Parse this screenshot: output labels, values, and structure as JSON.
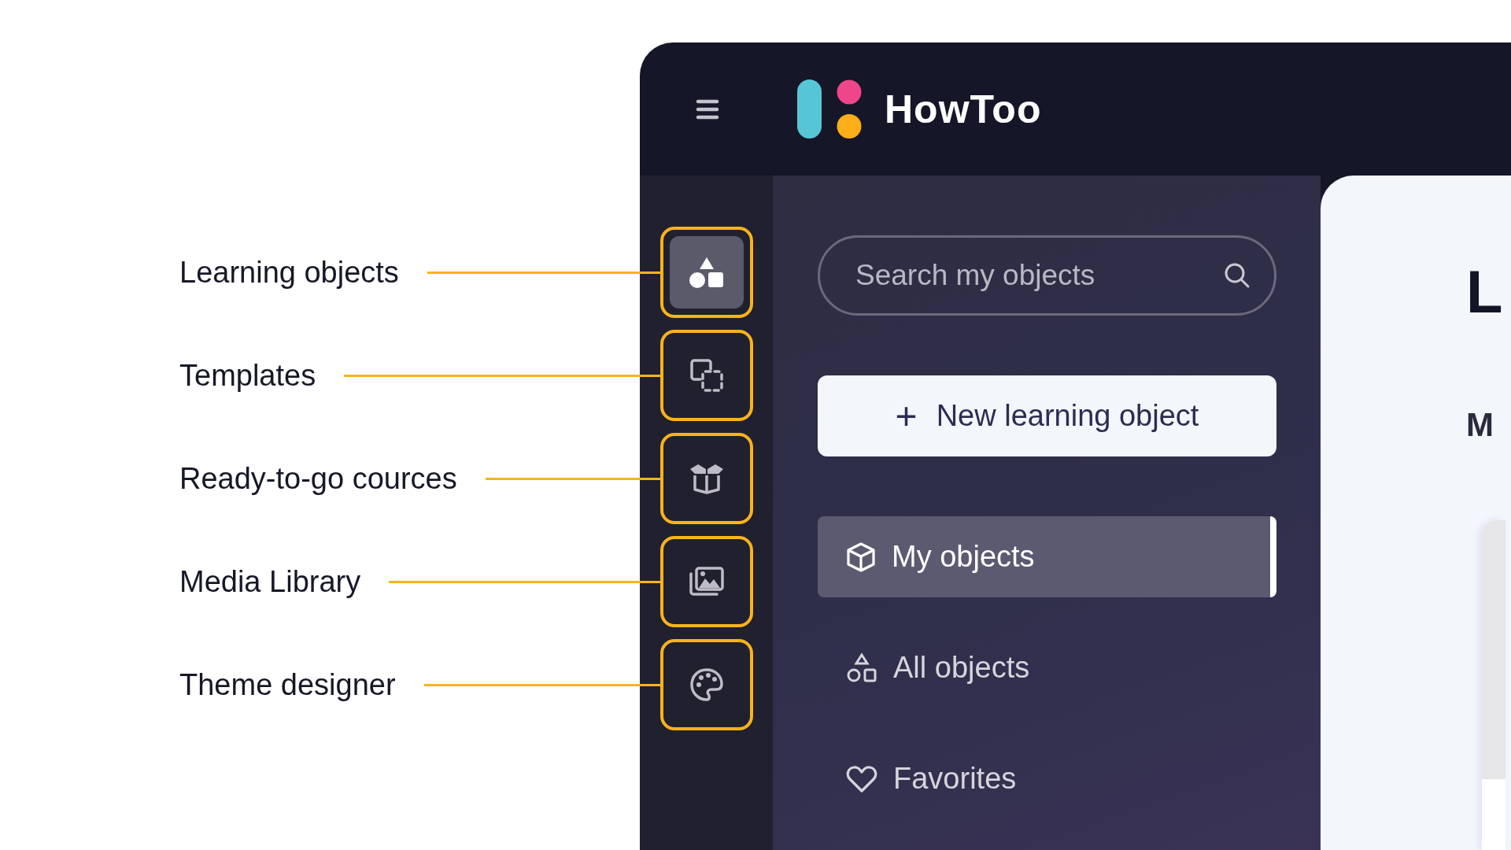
{
  "annotations": [
    {
      "label": "Learning objects"
    },
    {
      "label": "Templates"
    },
    {
      "label": "Ready-to-go cources"
    },
    {
      "label": "Media Library"
    },
    {
      "label": "Theme designer"
    }
  ],
  "header": {
    "logo_text": "HowToo"
  },
  "rail": {
    "items": [
      {
        "kind": "shapes",
        "selected": true
      },
      {
        "kind": "templates",
        "selected": false
      },
      {
        "kind": "box",
        "selected": false
      },
      {
        "kind": "media",
        "selected": false
      },
      {
        "kind": "palette",
        "selected": false
      }
    ]
  },
  "panel": {
    "search": {
      "placeholder": "Search my objects"
    },
    "new_button": {
      "icon": "+",
      "label": "New learning object"
    },
    "nav": [
      {
        "kind": "cube",
        "label": "My objects",
        "selected": true
      },
      {
        "kind": "shapes",
        "label": "All objects",
        "selected": false
      },
      {
        "kind": "heart",
        "label": "Favorites",
        "selected": false
      }
    ]
  },
  "main": {
    "title": "L",
    "subtitle": "M"
  }
}
